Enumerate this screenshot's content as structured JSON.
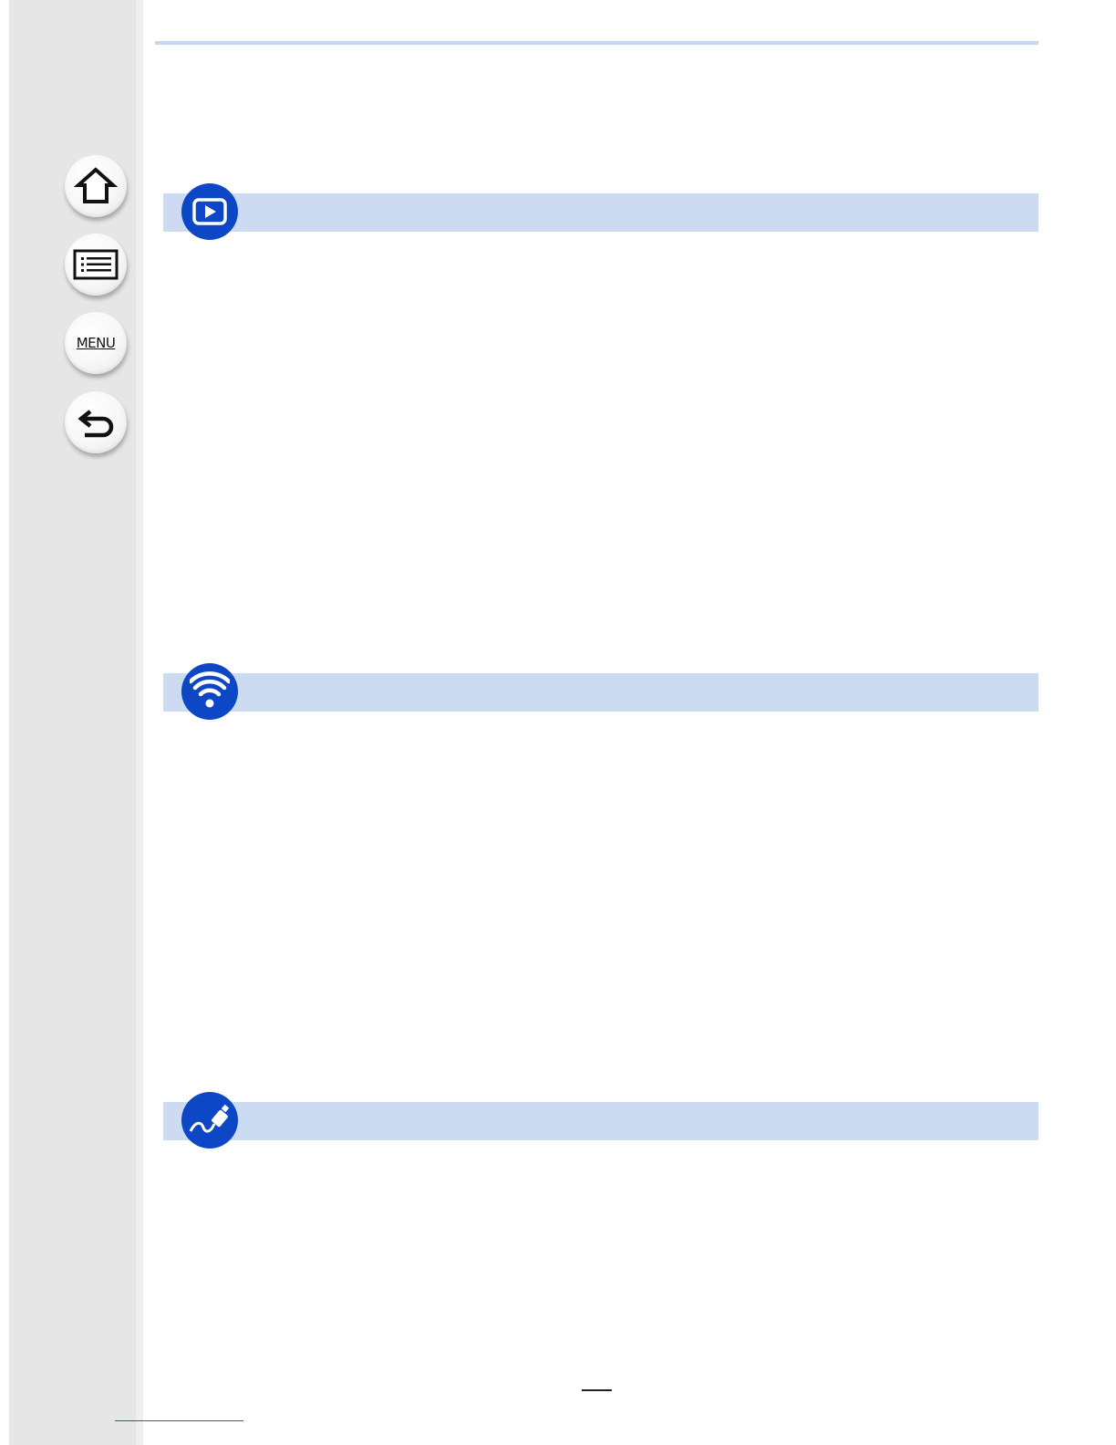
{
  "navigation": {
    "home": {
      "icon": "home-icon"
    },
    "contents": {
      "icon": "list-icon"
    },
    "menu": {
      "label": "MENU",
      "icon": "menu-icon"
    },
    "back": {
      "icon": "return-arrow-icon"
    }
  },
  "sections": [
    {
      "icon": "playback-icon",
      "color": "#0d47c6"
    },
    {
      "icon": "wifi-icon",
      "color": "#0d47c6"
    },
    {
      "icon": "cable-connection-icon",
      "color": "#0d47c6"
    }
  ],
  "colors": {
    "accent": "#0d47c6",
    "section_bar": "#ccdbf2",
    "sidebar": "#e6e6e6"
  }
}
